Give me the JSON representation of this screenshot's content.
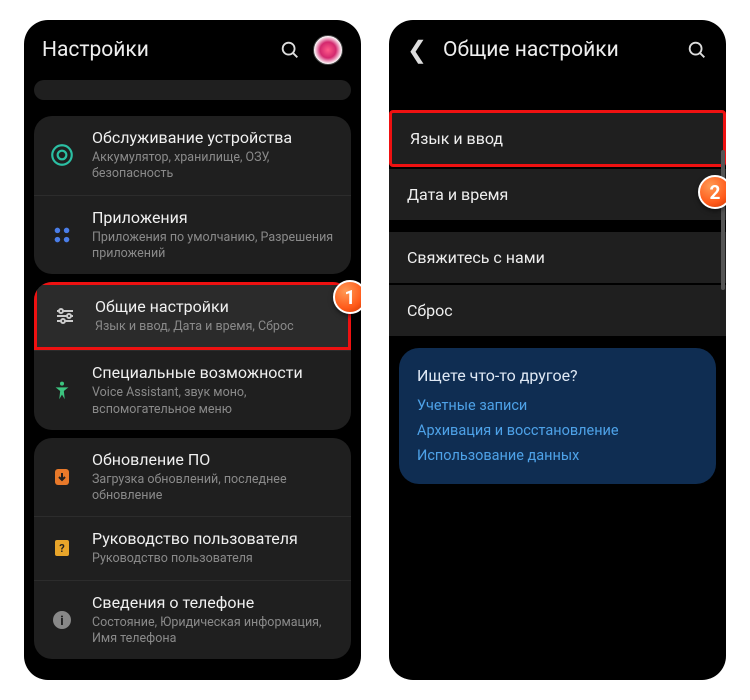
{
  "panel1": {
    "header": {
      "title": "Настройки"
    },
    "badge": "1",
    "groups": [
      {
        "rows": [
          {
            "icon": "device-care-icon",
            "title": "Обслуживание устройства",
            "sub": "Аккумулятор, хранилище, ОЗУ, безопасность"
          },
          {
            "icon": "apps-icon",
            "title": "Приложения",
            "sub": "Приложения по умолчанию, Разрешения приложений"
          }
        ]
      },
      {
        "rows": [
          {
            "icon": "sliders-icon",
            "title": "Общие настройки",
            "sub": "Язык и ввод, Дата и время, Сброс",
            "highlighted": true
          },
          {
            "icon": "accessibility-icon",
            "title": "Специальные возможности",
            "sub": "Voice Assistant, звук моно, вспомогательное меню"
          }
        ]
      },
      {
        "rows": [
          {
            "icon": "update-icon",
            "title": "Обновление ПО",
            "sub": "Загрузка обновлений, последнее обновление"
          },
          {
            "icon": "manual-icon",
            "title": "Руководство пользователя",
            "sub": "Руководство пользователя"
          },
          {
            "icon": "about-icon",
            "title": "Сведения о телефоне",
            "sub": "Состояние, Юридическая информация, Имя телефона"
          }
        ]
      }
    ]
  },
  "panel2": {
    "header": {
      "title": "Общие настройки"
    },
    "badge": "2",
    "rows_a": [
      {
        "title": "Язык и ввод",
        "highlighted": true
      },
      {
        "title": "Дата и время"
      }
    ],
    "rows_b": [
      {
        "title": "Свяжитесь с нами"
      },
      {
        "title": "Сброс"
      }
    ],
    "infobox": {
      "title": "Ищете что-то другое?",
      "links": [
        "Учетные записи",
        "Архивация и восстановление",
        "Использование данных"
      ]
    }
  }
}
